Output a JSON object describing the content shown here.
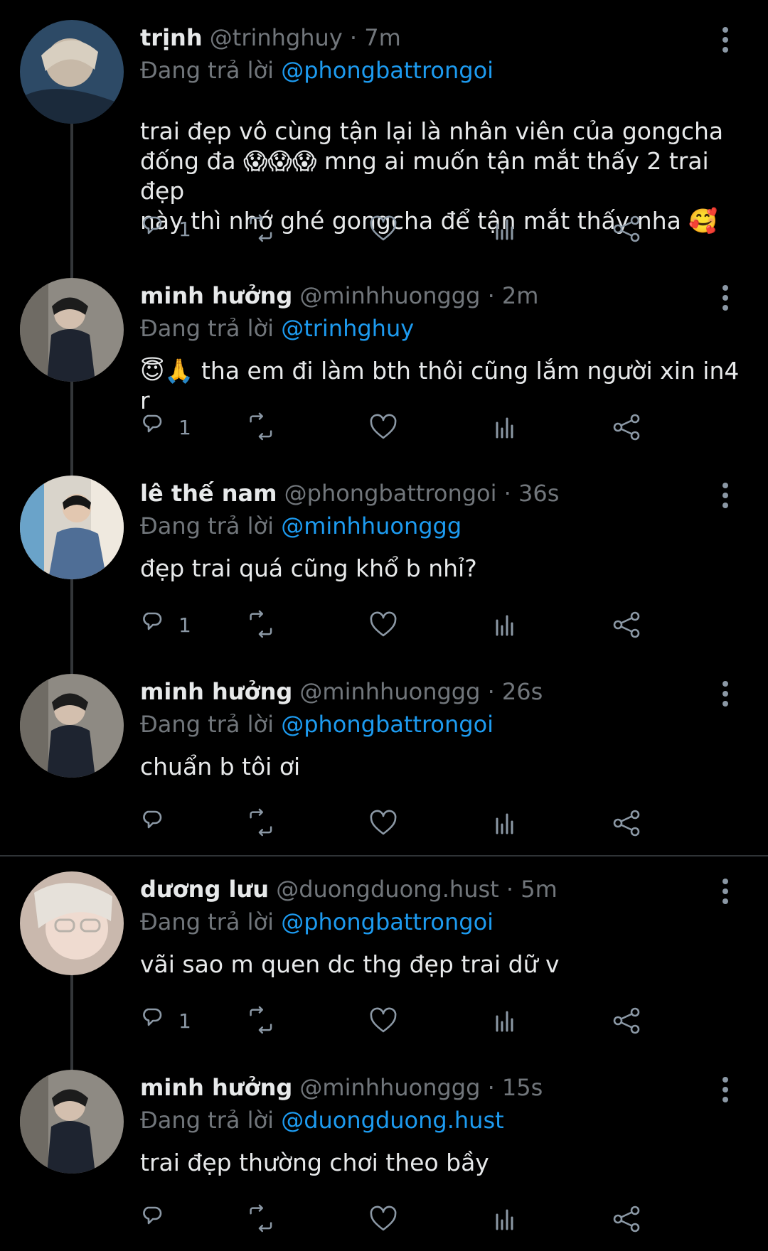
{
  "replying_prefix": "Đang trả lời",
  "tweets": [
    {
      "name": "trịnh",
      "handle": "@trinhghuy",
      "time": "7m",
      "reply_to": "@phongbattrongoi",
      "text_lines": [
        "trai đẹp vô cùng tận lại là nhân viên của gongcha",
        "đống đa 😱😱😱 mng ai muốn tận mắt thấy 2 trai đẹp",
        "này thì nhớ ghé gongcha để tận mắt thấy nha 🥰"
      ],
      "reply_count": "1"
    },
    {
      "name": "minh hưởng",
      "handle": "@minhhuonggg",
      "time": "2m",
      "reply_to": "@trinhghuy",
      "text_lines": [
        "😇🙏 tha em đi làm bth thôi cũng lắm người xin in4 r"
      ],
      "reply_count": "1"
    },
    {
      "name": "lê thế nam",
      "handle": "@phongbattrongoi",
      "time": "36s",
      "reply_to": "@minhhuonggg",
      "text_lines": [
        "đẹp trai quá cũng khổ b nhỉ?"
      ],
      "reply_count": "1"
    },
    {
      "name": "minh hưởng",
      "handle": "@minhhuonggg",
      "time": "26s",
      "reply_to": "@phongbattrongoi",
      "text_lines": [
        "chuẩn b tôi ơi"
      ],
      "reply_count": ""
    },
    {
      "name": "dương lưu",
      "handle": "@duongduong.hust",
      "time": "5m",
      "reply_to": "@phongbattrongoi",
      "text_lines": [
        "vãi sao m quen dc thg đẹp trai dữ v"
      ],
      "reply_count": "1"
    },
    {
      "name": "minh hưởng",
      "handle": "@minhhuonggg",
      "time": "15s",
      "reply_to": "@duongduong.hust",
      "text_lines": [
        "trai đẹp thường chơi theo bầy"
      ],
      "reply_count": ""
    }
  ],
  "icons": {
    "reply": "reply-icon",
    "retweet": "retweet-icon",
    "like": "heart-icon",
    "views": "views-icon",
    "share": "share-icon",
    "more": "more-vertical-icon"
  },
  "colors": {
    "background": "#000000",
    "text": "#e7e9ea",
    "secondary": "#71767b",
    "mention": "#1d9bf0",
    "icon": "#8b98a5"
  }
}
